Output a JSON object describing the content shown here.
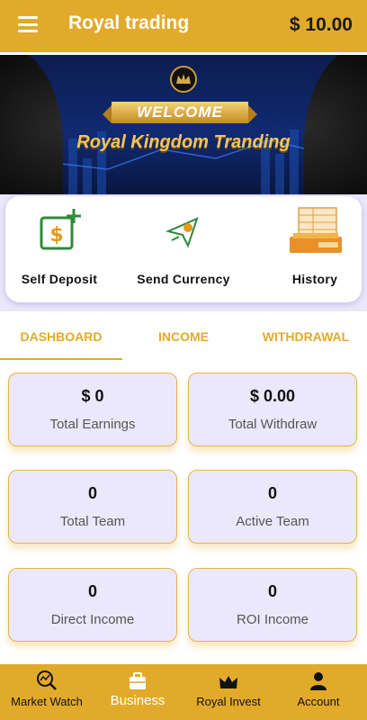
{
  "header": {
    "title": "Royal trading",
    "balance": "$ 10.00"
  },
  "banner": {
    "welcome": "WELCOME",
    "subtitle": "Royal Kingdom Tranding"
  },
  "quick_actions": [
    {
      "label": "Self Deposit",
      "icon": "dollar-plus-icon"
    },
    {
      "label": "Send Currency",
      "icon": "send-currency-icon"
    },
    {
      "label": "History",
      "icon": "passbook-icon"
    }
  ],
  "tabs": [
    {
      "label": "DASHBOARD",
      "active": true
    },
    {
      "label": "INCOME",
      "active": false
    },
    {
      "label": "WITHDRAWAL",
      "active": false
    }
  ],
  "stats": [
    {
      "value": "$ 0",
      "label": "Total Earnings"
    },
    {
      "value": "$ 0.00",
      "label": "Total Withdraw"
    },
    {
      "value": "0",
      "label": "Total Team"
    },
    {
      "value": "0",
      "label": "Active Team"
    },
    {
      "value": "0",
      "label": "Direct Income"
    },
    {
      "value": "0",
      "label": "ROI Income"
    }
  ],
  "bottom_nav": [
    {
      "label": "Market Watch",
      "icon": "market-watch-icon",
      "active": false
    },
    {
      "label": "Business",
      "icon": "briefcase-icon",
      "active": true
    },
    {
      "label": "Royal Invest",
      "icon": "crown-icon",
      "active": false
    },
    {
      "label": "Account",
      "icon": "user-icon",
      "active": false
    }
  ],
  "colors": {
    "accent": "#e2aa2a",
    "card_bg": "#ece8fb",
    "banner_bg": "#102a72"
  }
}
